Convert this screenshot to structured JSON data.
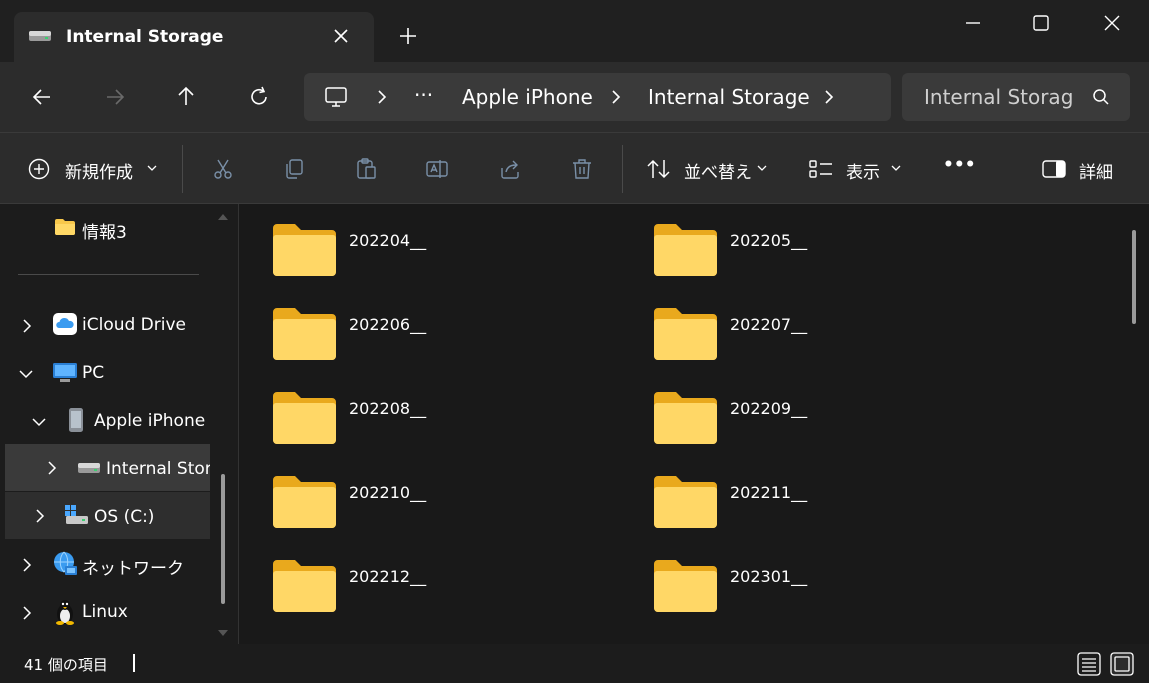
{
  "window": {
    "tab_title": "Internal Storage",
    "colors": {
      "titlebar": "#202020",
      "tab": "#2c2c2c",
      "folder": "#f8c84b",
      "selected": "#3a3a3a"
    }
  },
  "address": {
    "ellipsis": "···",
    "crumbs": [
      "Apple iPhone",
      "Internal Storage"
    ],
    "search_placeholder": "Internal Storag"
  },
  "toolbar": {
    "new_label": "新規作成",
    "sort_label": "並べ替え",
    "view_label": "表示",
    "more_label": "•••",
    "details_label": "詳細"
  },
  "sidebar": {
    "items": [
      {
        "label": "情報3",
        "icon": "folder-icon"
      },
      {
        "label": "iCloud Drive",
        "icon": "icloud-icon"
      },
      {
        "label": "PC",
        "icon": "pc-icon"
      },
      {
        "label": "Apple iPhone",
        "icon": "phone-icon"
      },
      {
        "label": "Internal Storage",
        "icon": "drive-icon"
      },
      {
        "label": "OS (C:)",
        "icon": "os-drive-icon"
      },
      {
        "label": "ネットワーク",
        "icon": "network-icon"
      },
      {
        "label": "Linux",
        "icon": "linux-icon"
      }
    ]
  },
  "folders": [
    "202204__",
    "202205__",
    "202206__",
    "202207__",
    "202208__",
    "202209__",
    "202210__",
    "202211__",
    "202212__",
    "202301__"
  ],
  "status": {
    "item_count": "41 個の項目"
  }
}
